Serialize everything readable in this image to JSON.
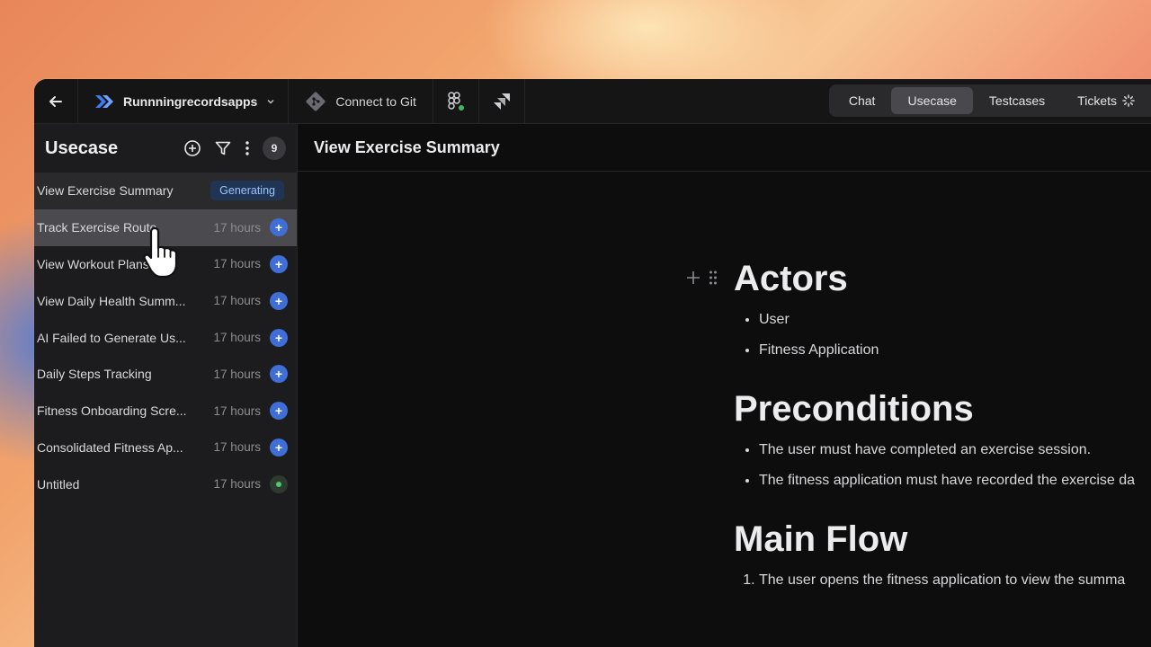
{
  "topbar": {
    "project_name": "Runnningrecordsapps",
    "connect_git": "Connect to Git",
    "tabs": [
      {
        "label": "Chat",
        "active": false
      },
      {
        "label": "Usecase",
        "active": true
      },
      {
        "label": "Testcases",
        "active": false
      },
      {
        "label": "Tickets",
        "active": false
      }
    ]
  },
  "sidebar": {
    "title": "Usecase",
    "count": "9",
    "items": [
      {
        "title": "View Exercise Summary",
        "status": "Generating"
      },
      {
        "title": "Track Exercise Route",
        "time": "17 hours"
      },
      {
        "title": "View Workout Plans",
        "time": "17 hours"
      },
      {
        "title": "View Daily Health Summ...",
        "time": "17 hours"
      },
      {
        "title": "AI Failed to Generate Us...",
        "time": "17 hours"
      },
      {
        "title": "Daily Steps Tracking",
        "time": "17 hours"
      },
      {
        "title": "Fitness Onboarding Scre...",
        "time": "17 hours"
      },
      {
        "title": "Consolidated Fitness Ap...",
        "time": "17 hours"
      },
      {
        "title": "Untitled",
        "time": "17 hours"
      }
    ]
  },
  "main": {
    "title": "View Exercise Summary",
    "sections": [
      {
        "heading": "Actors",
        "items": [
          "User",
          "Fitness Application"
        ]
      },
      {
        "heading": "Preconditions",
        "items": [
          "The user must have completed an exercise session.",
          "The fitness application must have recorded the exercise da"
        ]
      },
      {
        "heading": "Main Flow",
        "items": [
          "The user opens the fitness application to view the summa"
        ]
      }
    ]
  },
  "colors": {
    "accent": "#3f6ed6",
    "status_generating": "#9cc3ff",
    "status_ok": "#4cc96a"
  }
}
